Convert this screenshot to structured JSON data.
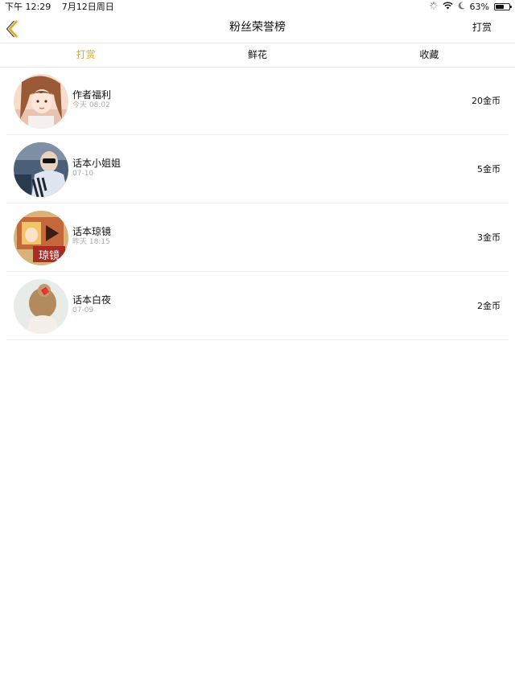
{
  "status_bar": {
    "time": "下午 12:29",
    "date": "7月12日周日",
    "battery_text": "63%",
    "battery_level": 0.63
  },
  "nav": {
    "title": "粉丝荣誉榜",
    "right_action": "打赏",
    "accent_color": "#e6a81e"
  },
  "tabs": [
    {
      "label": "打赏",
      "active": true
    },
    {
      "label": "鲜花",
      "active": false
    },
    {
      "label": "收藏",
      "active": false
    }
  ],
  "rows": [
    {
      "name": "作者福利",
      "time": "今天 08:02",
      "amount": "20金币"
    },
    {
      "name": "话本小姐姐",
      "time": "07-10",
      "amount": "5金币"
    },
    {
      "name": "话本琼镜",
      "time": "昨天 18:15",
      "amount": "3金币"
    },
    {
      "name": "话本白夜",
      "time": "07-09",
      "amount": "2金币"
    }
  ],
  "avatar_badge_text": "琼镜"
}
